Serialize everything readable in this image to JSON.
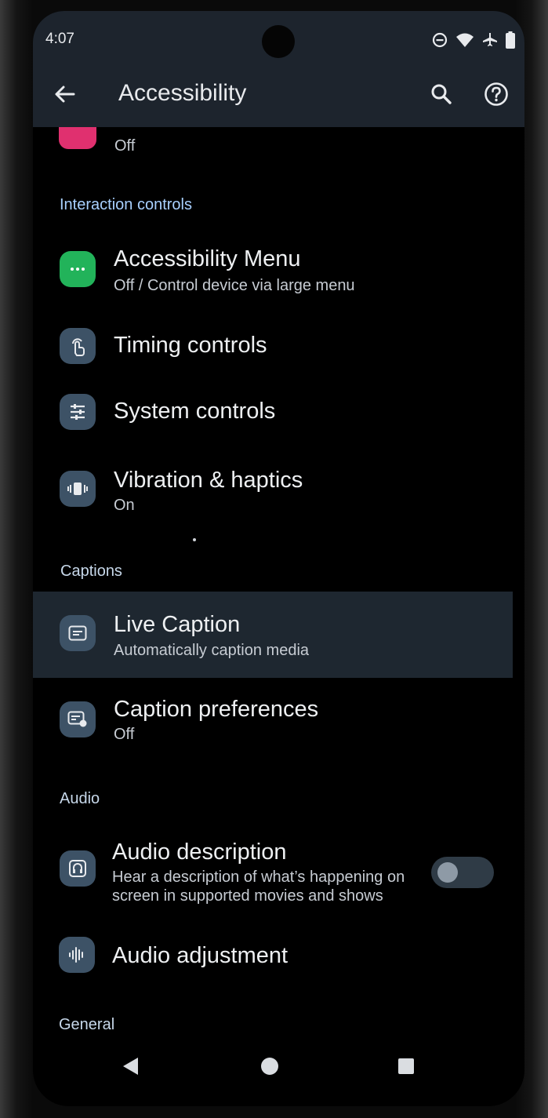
{
  "status_bar": {
    "time": "4:07",
    "icons": [
      "do-not-disturb-icon",
      "wifi-icon",
      "airplane-icon",
      "battery-icon"
    ]
  },
  "app_bar": {
    "title": "Accessibility",
    "back_icon": "arrow-left-icon",
    "search_icon": "search-icon",
    "help_icon": "help-icon"
  },
  "partial_item": {
    "subtitle": "Off"
  },
  "sections": {
    "interaction": "Interaction controls",
    "captions": "Captions",
    "audio": "Audio",
    "general": "General"
  },
  "items": {
    "accessibility_menu": {
      "title": "Accessibility Menu",
      "subtitle": "Off / Control device via large menu",
      "icon": "menu-dots-icon"
    },
    "timing_controls": {
      "title": "Timing controls",
      "icon": "touch-timer-icon"
    },
    "system_controls": {
      "title": "System controls",
      "icon": "sliders-icon"
    },
    "vibration": {
      "title": "Vibration & haptics",
      "subtitle": "On",
      "icon": "vibration-icon"
    },
    "live_caption": {
      "title": "Live Caption",
      "subtitle": "Automatically caption media",
      "icon": "caption-icon"
    },
    "caption_prefs": {
      "title": "Caption preferences",
      "subtitle": "Off",
      "icon": "caption-settings-icon"
    },
    "audio_description": {
      "title": "Audio description",
      "subtitle_line1": "Hear a description of what’s happening on",
      "subtitle_line2": "screen in supported movies and shows",
      "icon": "audio-description-icon",
      "toggle_on": false
    },
    "audio_adjustment": {
      "title": "Audio adjustment",
      "icon": "waveform-icon"
    }
  },
  "colors": {
    "accent_section": "#a9d1ff",
    "icon_bg": "#3d5266",
    "menu_icon_bg": "#22b35a",
    "appbar_bg": "#1d242d"
  },
  "nav_bar": {
    "icons": [
      "nav-back-icon",
      "nav-home-icon",
      "nav-recents-icon"
    ]
  }
}
